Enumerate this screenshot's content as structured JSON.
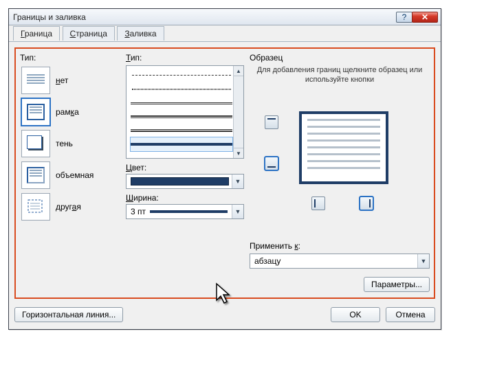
{
  "dialog": {
    "title": "Границы и заливка"
  },
  "tabs": [
    {
      "label": "Граница",
      "hotkey": "Г",
      "active": true
    },
    {
      "label": "Страница",
      "hotkey": "С"
    },
    {
      "label": "Заливка",
      "hotkey": "З"
    }
  ],
  "type_section": {
    "label": "Тип:",
    "items": [
      {
        "key": "none",
        "label": "нет"
      },
      {
        "key": "box",
        "label": "рамка",
        "hotkey": "к",
        "selected": true
      },
      {
        "key": "shadow",
        "label": "тень"
      },
      {
        "key": "3d",
        "label": "объемная"
      },
      {
        "key": "custom",
        "label": "другая"
      }
    ]
  },
  "style_section": {
    "label": "Тип:",
    "selected_index": 5
  },
  "color_section": {
    "label": "Цвет:",
    "value_hex": "#1f3d66"
  },
  "width_section": {
    "label": "Ширина:",
    "value": "3 пт"
  },
  "preview": {
    "label": "Образец",
    "instruction": "Для добавления границ щелкните образец или используйте кнопки"
  },
  "apply_to": {
    "label": "Применить к:",
    "value": "абзацу"
  },
  "buttons": {
    "options": "Параметры...",
    "hline": "Горизонтальная линия...",
    "ok": "OK",
    "cancel": "Отмена"
  }
}
